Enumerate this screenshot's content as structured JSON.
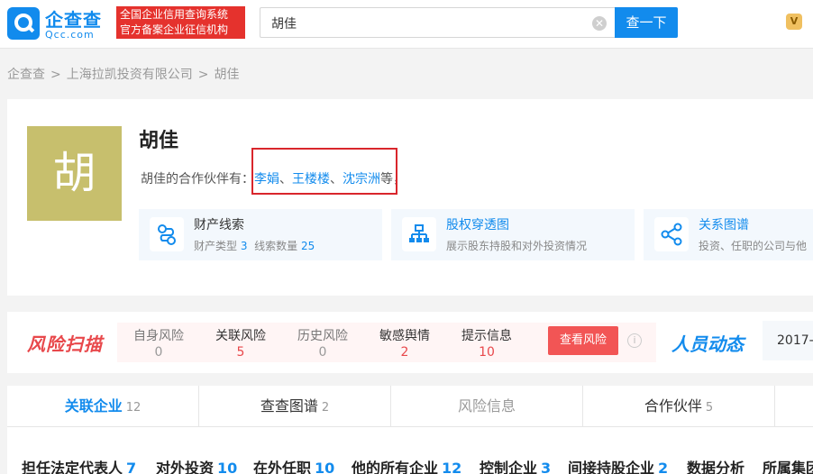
{
  "header": {
    "logo_cn": "企查查",
    "logo_en": "Qcc.com",
    "slogan_line1": "全国企业信用查询系统",
    "slogan_line2": "官方备案企业征信机构",
    "search_value": "胡佳",
    "search_button": "查一下",
    "vip_icon": "V"
  },
  "breadcrumb": [
    "企查查",
    "上海拉凯投资有限公司",
    "胡佳"
  ],
  "profile": {
    "avatar_char": "胡",
    "name": "胡佳",
    "partners_prefix": "胡佳的合作伙伴有：",
    "partners": [
      "李娟",
      "王楼楼",
      "沈宗洲"
    ],
    "partners_sep": "、",
    "partners_suffix": "等，",
    "features": [
      {
        "title": "财产线索",
        "desc_a": "财产类型",
        "val_a": "3",
        "desc_b": "线索数量",
        "val_b": "25",
        "icon": "route-icon"
      },
      {
        "title": "股权穿透图",
        "desc": "展示股东持股和对外投资情况",
        "icon": "org-chart-icon"
      },
      {
        "title": "关系图谱",
        "desc": "投资、任职的公司与他",
        "icon": "share-icon"
      }
    ]
  },
  "risk": {
    "title": "风险扫描",
    "items": [
      {
        "label": "自身风险",
        "value": "0"
      },
      {
        "label": "关联风险",
        "value": "5"
      },
      {
        "label": "历史风险",
        "value": "0"
      },
      {
        "label": "敏感舆情",
        "value": "2"
      },
      {
        "label": "提示信息",
        "value": "10"
      }
    ],
    "button": "查看风险",
    "info_icon": "i",
    "people_title": "人员动态",
    "people_date": "2017-"
  },
  "tabs": [
    {
      "label": "关联企业",
      "count": "12"
    },
    {
      "label": "查查图谱",
      "count": "2"
    },
    {
      "label": "风险信息",
      "count": ""
    },
    {
      "label": "合作伙伴",
      "count": "5"
    }
  ],
  "subtabs": [
    {
      "label": "担任法定代表人",
      "count": "7"
    },
    {
      "label": "对外投资",
      "count": "10"
    },
    {
      "label": "在外任职",
      "count": "10"
    },
    {
      "label": "他的所有企业",
      "count": "12"
    },
    {
      "label": "控制企业",
      "count": "3"
    },
    {
      "label": "间接持股企业",
      "count": "2"
    },
    {
      "label": "数据分析",
      "count": ""
    },
    {
      "label": "所属集团",
      "count": ""
    }
  ],
  "colors": {
    "brand": "#128bed",
    "risk": "#e8484b",
    "highlight": "#d9262c",
    "avatar": "#c7bf6d"
  }
}
